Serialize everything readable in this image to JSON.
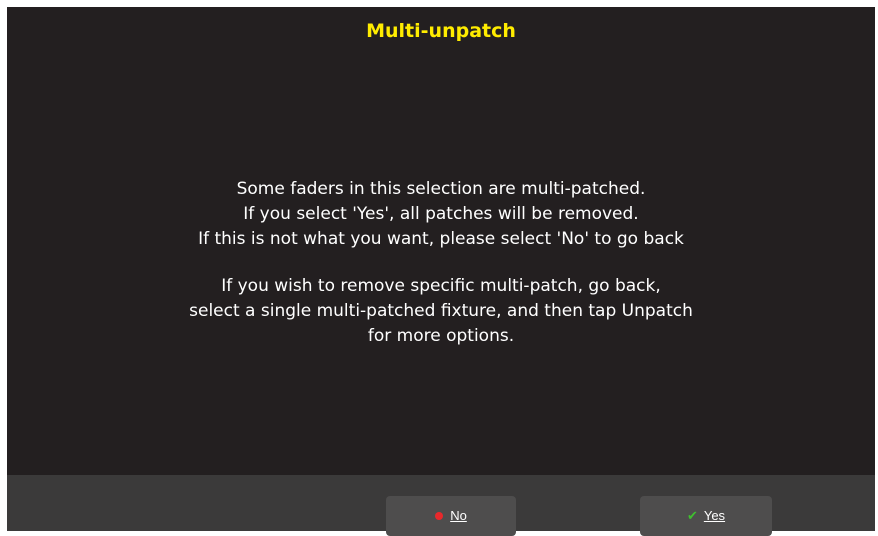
{
  "dialog": {
    "title": "Multi-unpatch",
    "message_lines": [
      "Some faders in this selection are multi-patched.",
      "If you select 'Yes', all patches will be removed.",
      "If this is not what you want, please select 'No' to go back",
      "If you wish to remove specific multi-patch, go back,",
      "select a single multi-patched fixture, and then tap Unpatch",
      "for more options."
    ]
  },
  "buttons": {
    "no": {
      "label": "No",
      "icon": "red-dot-icon",
      "icon_color": "#e8282b"
    },
    "yes": {
      "label": "Yes",
      "icon": "checkmark-icon",
      "icon_color": "#3fbf2f"
    }
  },
  "colors": {
    "background": "#231f20",
    "title": "#ffec00",
    "text": "#ffffff",
    "footer": "#3b3a3a",
    "button": "#4e4d4d"
  }
}
